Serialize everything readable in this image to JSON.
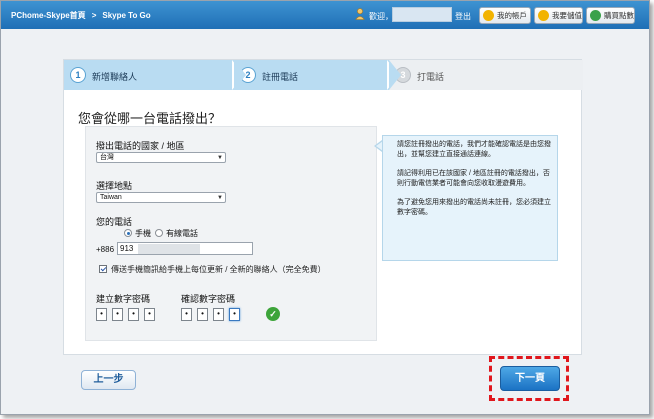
{
  "topbar": {
    "breadcrumb": [
      "PChome-Skype首頁",
      "Skype To Go"
    ],
    "separator": ">",
    "welcome": "歡迎，",
    "logout": "登出",
    "buttons": [
      {
        "label": "我的帳戶",
        "icon": "account-icon",
        "color": "#f2b300"
      },
      {
        "label": "我要儲值",
        "icon": "topup-icon",
        "color": "#f2b300"
      },
      {
        "label": "購買點數",
        "icon": "buy-points-icon",
        "color": "#3aa14a"
      }
    ]
  },
  "steps": [
    {
      "num": "1",
      "label": "新增聯絡人",
      "state": "done"
    },
    {
      "num": "2",
      "label": "註冊電話",
      "state": "current"
    },
    {
      "num": "3",
      "label": "打電話",
      "state": "pending"
    }
  ],
  "form": {
    "question": "您會從哪一台電話撥出？",
    "country_label": "撥出電話的國家 / 地區",
    "country_value": "台灣",
    "region_label": "選擇地點",
    "region_value": "Taiwan",
    "phone_label": "您的電話",
    "phone_types": [
      "手機",
      "有線電話"
    ],
    "phone_type_selected": "手機",
    "phone_prefix": "+886",
    "phone_value": "913",
    "sms_checkbox_label": "傳送手機簡訊給手機上每位更新 / 全新的聯絡人（完全免費）",
    "sms_checked": true,
    "pin_label": "建立數字密碼",
    "pin_confirm_label": "確認數字密碼",
    "pin_digits": [
      "•",
      "•",
      "•",
      "•"
    ],
    "pin_confirm_digits": [
      "•",
      "•",
      "•",
      "•"
    ],
    "pin_match": true
  },
  "info": {
    "p1": "請您註冊撥出的電話，我們才能確認電話是由您撥出，並幫您建立直接通話連線。",
    "p2": "請記得利用已在該國家 / 地區註冊的電話撥出，否則行動電信業者可能會向您收取漫遊費用。",
    "p3": "為了避免您用來撥出的電話尚未註冊，您必須建立數字密碼。"
  },
  "nav": {
    "back_label": "上一步",
    "next_label": "下一頁"
  },
  "colors": {
    "topbar": "#2a80c6",
    "step_active": "#b9dcf2",
    "next_button": "#2a86d4",
    "highlight": "#e0161c"
  }
}
